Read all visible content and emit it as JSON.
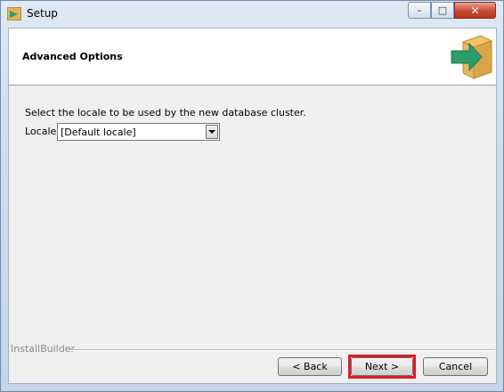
{
  "window": {
    "title": "Setup",
    "minimize_label": "–",
    "maximize_label": "□",
    "close_label": "✕"
  },
  "header": {
    "title": "Advanced Options",
    "logo_icon": "setup-box-arrow-icon"
  },
  "content": {
    "instruction": "Select the locale to be used by the new database cluster.",
    "locale_label": "Locale",
    "locale_value": "[Default locale]"
  },
  "footer": {
    "brand": "InstallBuilder",
    "back_label": "< Back",
    "next_label": "Next >",
    "cancel_label": "Cancel"
  },
  "colors": {
    "highlight": "#e01b24",
    "logo_box": "#e2b45a",
    "logo_arrow": "#2a9d6b"
  }
}
